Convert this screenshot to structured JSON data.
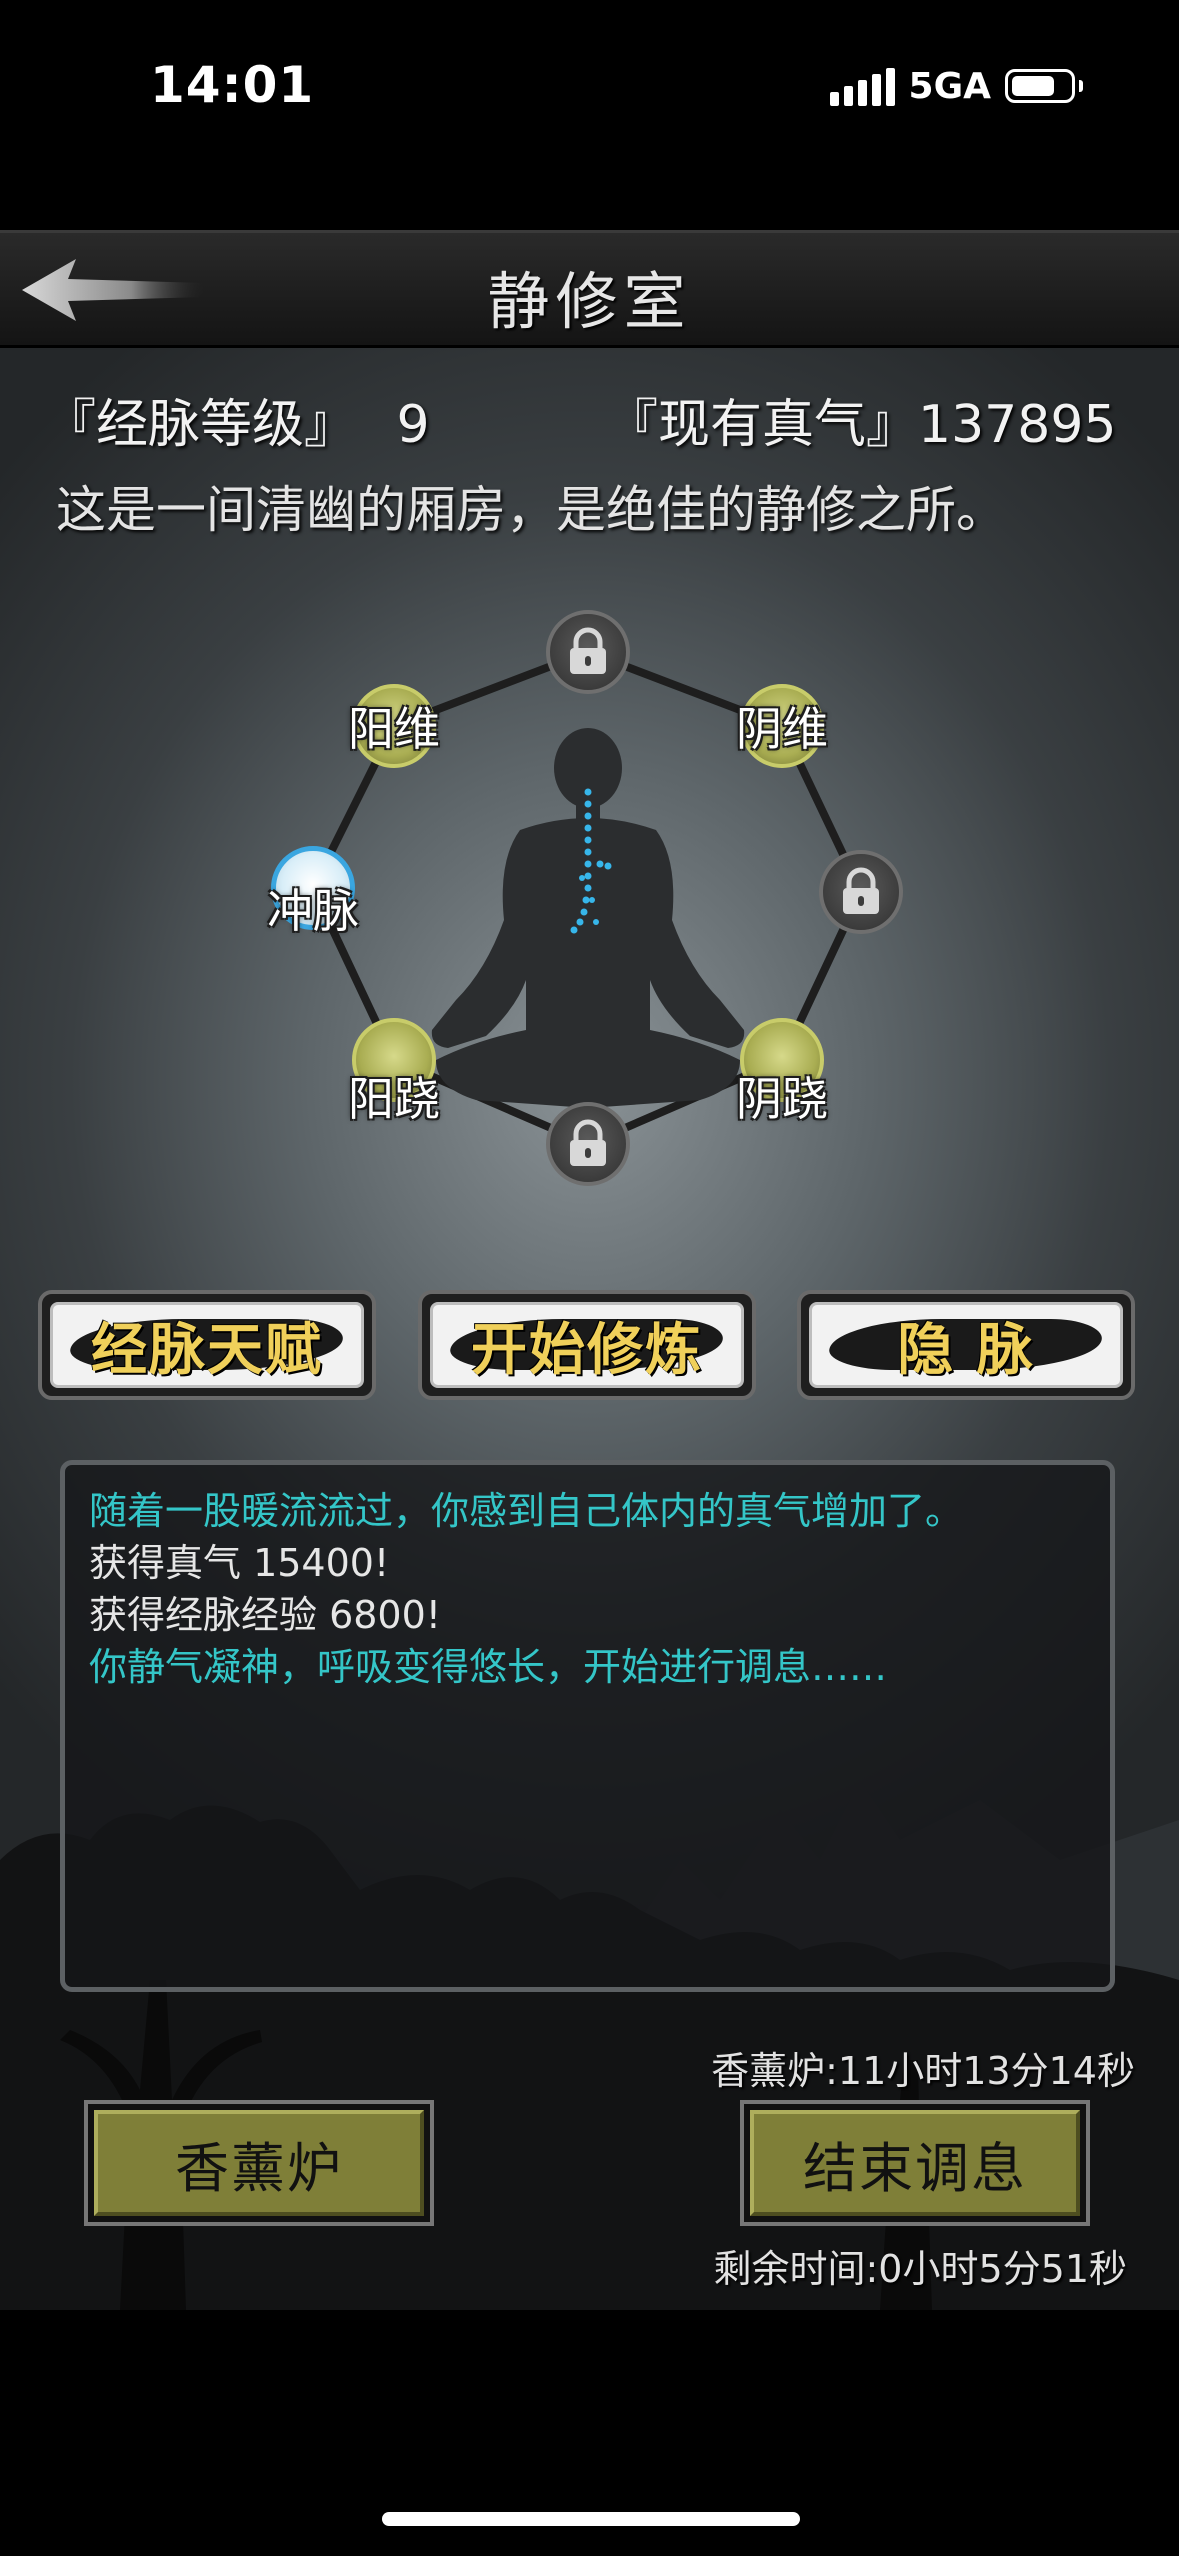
{
  "status_bar": {
    "time": "14:01",
    "network": "5GA"
  },
  "header": {
    "title": "静修室"
  },
  "stats": {
    "level_label": "『经脉等级』",
    "level_value": "9",
    "qi_label": "『现有真气』",
    "qi_value": "137895"
  },
  "description": "这是一间清幽的厢房，是绝佳的静修之所。",
  "meridians": {
    "top": {
      "label": "",
      "state": "locked"
    },
    "top_right": {
      "label": "阴维",
      "state": "unlocked"
    },
    "right": {
      "label": "",
      "state": "locked"
    },
    "bottom_right": {
      "label": "阴跷",
      "state": "unlocked"
    },
    "bottom": {
      "label": "",
      "state": "locked"
    },
    "bottom_left": {
      "label": "阳跷",
      "state": "unlocked"
    },
    "left": {
      "label": "冲脉",
      "state": "active"
    },
    "top_left": {
      "label": "阳维",
      "state": "unlocked"
    }
  },
  "action_buttons": {
    "talent": "经脉天赋",
    "start": "开始修炼",
    "hidden": "隐 脉"
  },
  "log": [
    {
      "text": "随着一股暖流流过，你感到自己体内的真气增加了。",
      "color": "cyan"
    },
    {
      "text": "获得真气 15400!",
      "color": "white"
    },
    {
      "text": "获得经脉经验 6800!",
      "color": "white"
    },
    {
      "text": "你静气凝神，呼吸变得悠长，开始进行调息……",
      "color": "cyan"
    }
  ],
  "incense_timer": "香薰炉:11小时13分14秒",
  "bottom_buttons": {
    "incense": "香薰炉",
    "end_rest": "结束调息"
  },
  "remaining_time": "剩余时间:0小时5分51秒",
  "colors": {
    "accent_yellow": "#f0d05a",
    "log_cyan": "#34c6c8",
    "active_ring": "#3aa6e0",
    "button_olive": "#7f7f38"
  }
}
